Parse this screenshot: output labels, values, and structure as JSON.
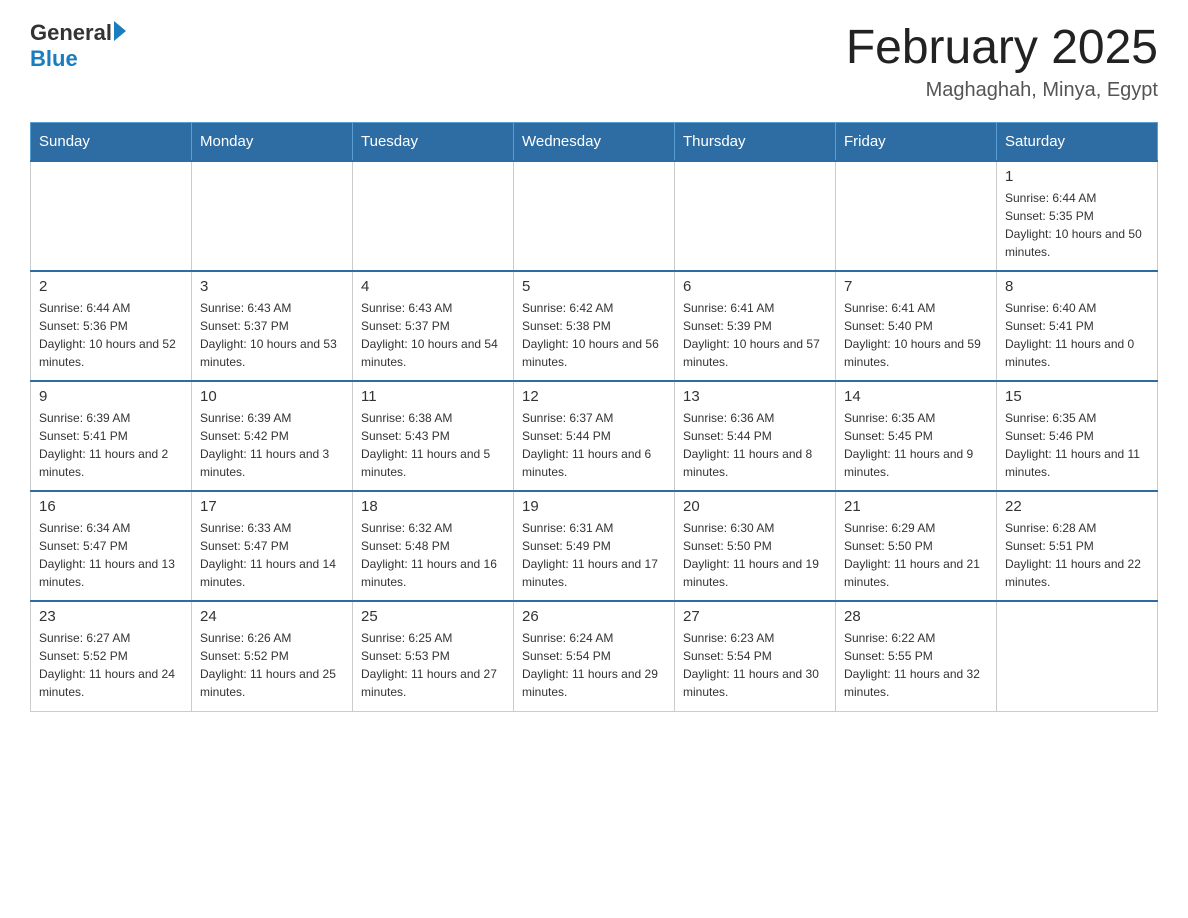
{
  "header": {
    "logo_general": "General",
    "logo_blue": "Blue",
    "month_title": "February 2025",
    "location": "Maghaghah, Minya, Egypt"
  },
  "days_of_week": [
    "Sunday",
    "Monday",
    "Tuesday",
    "Wednesday",
    "Thursday",
    "Friday",
    "Saturday"
  ],
  "weeks": [
    [
      {
        "day": "",
        "info": ""
      },
      {
        "day": "",
        "info": ""
      },
      {
        "day": "",
        "info": ""
      },
      {
        "day": "",
        "info": ""
      },
      {
        "day": "",
        "info": ""
      },
      {
        "day": "",
        "info": ""
      },
      {
        "day": "1",
        "info": "Sunrise: 6:44 AM\nSunset: 5:35 PM\nDaylight: 10 hours and 50 minutes."
      }
    ],
    [
      {
        "day": "2",
        "info": "Sunrise: 6:44 AM\nSunset: 5:36 PM\nDaylight: 10 hours and 52 minutes."
      },
      {
        "day": "3",
        "info": "Sunrise: 6:43 AM\nSunset: 5:37 PM\nDaylight: 10 hours and 53 minutes."
      },
      {
        "day": "4",
        "info": "Sunrise: 6:43 AM\nSunset: 5:37 PM\nDaylight: 10 hours and 54 minutes."
      },
      {
        "day": "5",
        "info": "Sunrise: 6:42 AM\nSunset: 5:38 PM\nDaylight: 10 hours and 56 minutes."
      },
      {
        "day": "6",
        "info": "Sunrise: 6:41 AM\nSunset: 5:39 PM\nDaylight: 10 hours and 57 minutes."
      },
      {
        "day": "7",
        "info": "Sunrise: 6:41 AM\nSunset: 5:40 PM\nDaylight: 10 hours and 59 minutes."
      },
      {
        "day": "8",
        "info": "Sunrise: 6:40 AM\nSunset: 5:41 PM\nDaylight: 11 hours and 0 minutes."
      }
    ],
    [
      {
        "day": "9",
        "info": "Sunrise: 6:39 AM\nSunset: 5:41 PM\nDaylight: 11 hours and 2 minutes."
      },
      {
        "day": "10",
        "info": "Sunrise: 6:39 AM\nSunset: 5:42 PM\nDaylight: 11 hours and 3 minutes."
      },
      {
        "day": "11",
        "info": "Sunrise: 6:38 AM\nSunset: 5:43 PM\nDaylight: 11 hours and 5 minutes."
      },
      {
        "day": "12",
        "info": "Sunrise: 6:37 AM\nSunset: 5:44 PM\nDaylight: 11 hours and 6 minutes."
      },
      {
        "day": "13",
        "info": "Sunrise: 6:36 AM\nSunset: 5:44 PM\nDaylight: 11 hours and 8 minutes."
      },
      {
        "day": "14",
        "info": "Sunrise: 6:35 AM\nSunset: 5:45 PM\nDaylight: 11 hours and 9 minutes."
      },
      {
        "day": "15",
        "info": "Sunrise: 6:35 AM\nSunset: 5:46 PM\nDaylight: 11 hours and 11 minutes."
      }
    ],
    [
      {
        "day": "16",
        "info": "Sunrise: 6:34 AM\nSunset: 5:47 PM\nDaylight: 11 hours and 13 minutes."
      },
      {
        "day": "17",
        "info": "Sunrise: 6:33 AM\nSunset: 5:47 PM\nDaylight: 11 hours and 14 minutes."
      },
      {
        "day": "18",
        "info": "Sunrise: 6:32 AM\nSunset: 5:48 PM\nDaylight: 11 hours and 16 minutes."
      },
      {
        "day": "19",
        "info": "Sunrise: 6:31 AM\nSunset: 5:49 PM\nDaylight: 11 hours and 17 minutes."
      },
      {
        "day": "20",
        "info": "Sunrise: 6:30 AM\nSunset: 5:50 PM\nDaylight: 11 hours and 19 minutes."
      },
      {
        "day": "21",
        "info": "Sunrise: 6:29 AM\nSunset: 5:50 PM\nDaylight: 11 hours and 21 minutes."
      },
      {
        "day": "22",
        "info": "Sunrise: 6:28 AM\nSunset: 5:51 PM\nDaylight: 11 hours and 22 minutes."
      }
    ],
    [
      {
        "day": "23",
        "info": "Sunrise: 6:27 AM\nSunset: 5:52 PM\nDaylight: 11 hours and 24 minutes."
      },
      {
        "day": "24",
        "info": "Sunrise: 6:26 AM\nSunset: 5:52 PM\nDaylight: 11 hours and 25 minutes."
      },
      {
        "day": "25",
        "info": "Sunrise: 6:25 AM\nSunset: 5:53 PM\nDaylight: 11 hours and 27 minutes."
      },
      {
        "day": "26",
        "info": "Sunrise: 6:24 AM\nSunset: 5:54 PM\nDaylight: 11 hours and 29 minutes."
      },
      {
        "day": "27",
        "info": "Sunrise: 6:23 AM\nSunset: 5:54 PM\nDaylight: 11 hours and 30 minutes."
      },
      {
        "day": "28",
        "info": "Sunrise: 6:22 AM\nSunset: 5:55 PM\nDaylight: 11 hours and 32 minutes."
      },
      {
        "day": "",
        "info": ""
      }
    ]
  ]
}
